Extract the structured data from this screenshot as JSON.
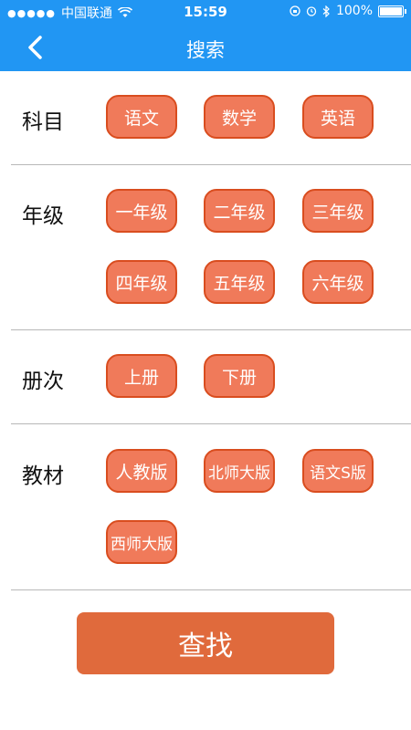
{
  "status_bar": {
    "carrier": "中国联通",
    "time": "15:59",
    "battery": "100%"
  },
  "nav": {
    "title": "搜索"
  },
  "sections": {
    "subject": {
      "label": "科目",
      "options": [
        "语文",
        "数学",
        "英语"
      ]
    },
    "grade": {
      "label": "年级",
      "options": [
        "一年级",
        "二年级",
        "三年级",
        "四年级",
        "五年级",
        "六年级"
      ]
    },
    "volume": {
      "label": "册次",
      "options": [
        "上册",
        "下册"
      ]
    },
    "textbook": {
      "label": "教材",
      "options": [
        "人教版",
        "北师大版",
        "语文S版",
        "西师大版"
      ]
    }
  },
  "search_button": {
    "label": "查找"
  },
  "colors": {
    "header": "#2196f3",
    "option_fill": "#f07a5a",
    "option_border": "#d94d1f",
    "button": "#e06a3c"
  }
}
